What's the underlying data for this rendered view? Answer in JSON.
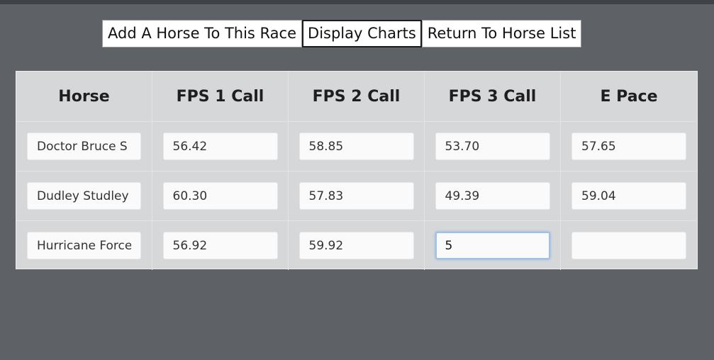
{
  "toolbar": {
    "add_horse_label": "Add A Horse To This Race",
    "display_charts_label": "Display Charts",
    "return_label": "Return To Horse List"
  },
  "table": {
    "headers": [
      "Horse",
      "FPS 1 Call",
      "FPS 2 Call",
      "FPS 3 Call",
      "E Pace"
    ],
    "rows": [
      {
        "horse": "Doctor Bruce S",
        "fps1": "56.42",
        "fps2": "58.85",
        "fps3": "53.70",
        "epace": "57.65"
      },
      {
        "horse": "Dudley Studley",
        "fps1": "60.30",
        "fps2": "57.83",
        "fps3": "49.39",
        "epace": "59.04"
      },
      {
        "horse": "Hurricane Force",
        "fps1": "56.92",
        "fps2": "59.92",
        "fps3": "5",
        "epace": ""
      }
    ]
  }
}
